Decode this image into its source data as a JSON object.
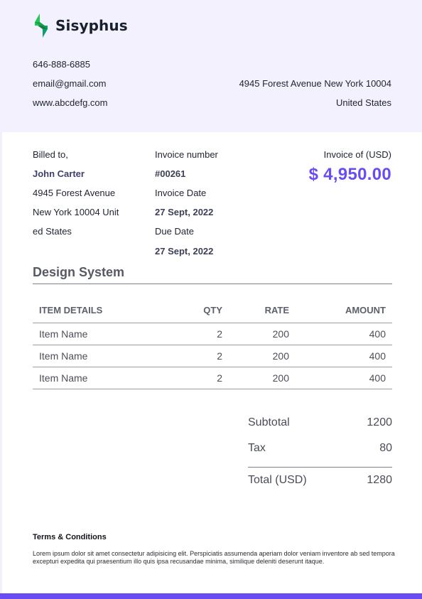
{
  "brand": {
    "name": "Sisyphus",
    "logo_icon": "bolt-logo-icon",
    "logo_colors": [
      "#0e9f6e",
      "#22c55e"
    ]
  },
  "contact": {
    "phone": "646-888-6885",
    "email": "email@gmail.com",
    "website": "www.abcdefg.com"
  },
  "company_address": {
    "street": "4945 Forest Avenue New York 10004",
    "country": "United States"
  },
  "billed_to": {
    "label": "Billed to,",
    "name": "John Carter",
    "line1": "4945 Forest Avenue",
    "line2": "New York 10004 Unit",
    "line3": "ed States"
  },
  "invoice": {
    "number_label": "Invoice number",
    "number": "#00261",
    "date_label": "Invoice Date",
    "date": "27 Sept, 2022",
    "due_label": "Due Date",
    "due": "27 Sept, 2022",
    "amount_label": "Invoice of (USD)",
    "amount": "$ 4,950.00"
  },
  "project": {
    "title": "Design System"
  },
  "table": {
    "headers": [
      "ITEM DETAILS",
      "QTY",
      "RATE",
      "AMOUNT"
    ],
    "rows": [
      {
        "item": "Item Name",
        "qty": "2",
        "rate": "200",
        "amount": "400"
      },
      {
        "item": "Item Name",
        "qty": "2",
        "rate": "200",
        "amount": "400"
      },
      {
        "item": "Item Name",
        "qty": "2",
        "rate": "200",
        "amount": "400"
      }
    ]
  },
  "totals": {
    "subtotal_label": "Subtotal",
    "subtotal": "1200",
    "tax_label": "Tax",
    "tax": "80",
    "total_label": "Total (USD)",
    "total": "1280"
  },
  "terms": {
    "title": "Terms & Conditions",
    "body": "Lorem ipsum dolor sit amet consectetur adipisicing elit. Perspiciatis assumenda aperiam dolor veniam inventore ab sed tempora excepturi expedita qui praesentium illo quis ipsa recusandae minima, similique deleniti deserunt itaque."
  },
  "colors": {
    "accent": "#6a4cf5",
    "header_bg": "#f2f1fd",
    "name_color": "#3e3f6a"
  }
}
